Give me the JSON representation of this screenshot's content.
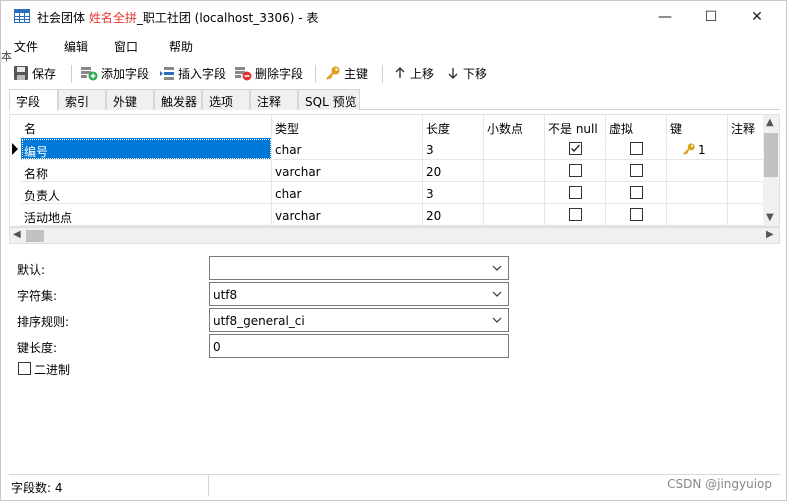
{
  "window": {
    "title_prefix": "社会团体",
    "title_highlight": "姓名全拼",
    "title_suffix": "_职工社团 (localhost_3306) - 表",
    "minimize": "—",
    "maximize": "☐",
    "close": "✕"
  },
  "menu": [
    "文件",
    "编辑",
    "窗口",
    "帮助"
  ],
  "toolbar": {
    "save": "保存",
    "add_field": "添加字段",
    "insert_field": "插入字段",
    "delete_field": "删除字段",
    "primary_key": "主键",
    "move_up": "上移",
    "move_down": "下移"
  },
  "tabs": [
    "字段",
    "索引",
    "外键",
    "触发器",
    "选项",
    "注释",
    "SQL 预览"
  ],
  "grid": {
    "columns": [
      "名",
      "类型",
      "长度",
      "小数点",
      "不是 null",
      "虚拟",
      "键",
      "注释"
    ],
    "rows": [
      {
        "name": "编号",
        "type": "char",
        "length": "3",
        "decimals": "",
        "not_null": true,
        "virtual": false,
        "key": "1"
      },
      {
        "name": "名称",
        "type": "varchar",
        "length": "20",
        "decimals": "",
        "not_null": false,
        "virtual": false,
        "key": ""
      },
      {
        "name": "负责人",
        "type": "char",
        "length": "3",
        "decimals": "",
        "not_null": false,
        "virtual": false,
        "key": ""
      },
      {
        "name": "活动地点",
        "type": "varchar",
        "length": "20",
        "decimals": "",
        "not_null": false,
        "virtual": false,
        "key": ""
      }
    ]
  },
  "props": {
    "default_label": "默认:",
    "default_value": "",
    "charset_label": "字符集:",
    "charset_value": "utf8",
    "collation_label": "排序规则:",
    "collation_value": "utf8_general_ci",
    "keylen_label": "键长度:",
    "keylen_value": "0",
    "binary_label": "二进制"
  },
  "status": {
    "field_count": "字段数: 4"
  },
  "watermark": "CSDN @jingyuiop",
  "side_fragment": "本",
  "colors": {
    "accent": "#0078d7",
    "title_highlight": "#e8392f",
    "key_icon": "#d9a21b"
  }
}
